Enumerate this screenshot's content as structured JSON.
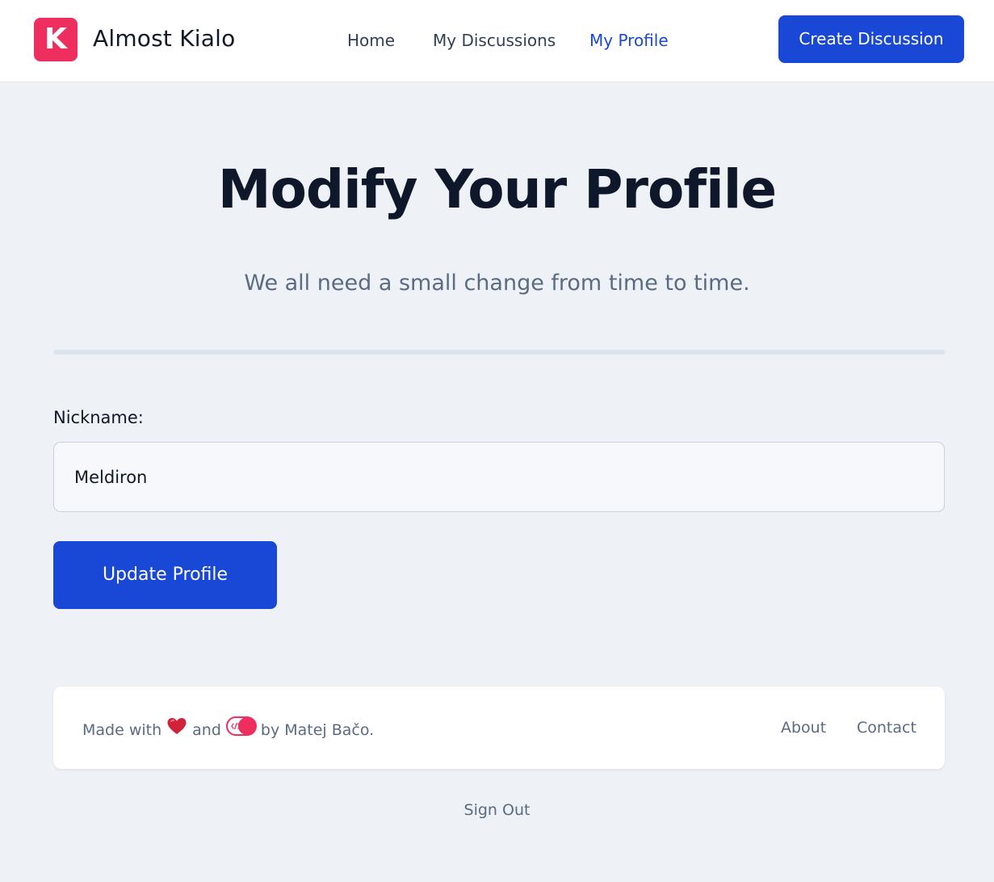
{
  "header": {
    "logo_letter": "K",
    "brand": "Almost Kialo",
    "nav": [
      {
        "label": "Home",
        "active": false
      },
      {
        "label": "My Discussions",
        "active": false
      },
      {
        "label": "My Profile",
        "active": true
      }
    ],
    "cta_label": "Create Discussion"
  },
  "main": {
    "title": "Modify Your Profile",
    "subtitle": "We all need a small change from time to time.",
    "form": {
      "nickname_label": "Nickname:",
      "nickname_value": "Meldiron",
      "submit_label": "Update Profile"
    }
  },
  "footer": {
    "text_made_with": "Made with",
    "text_and": "and",
    "text_by": "by Matej Bačo.",
    "icons": [
      "heart-icon",
      "toggle-icon"
    ],
    "links": [
      "About",
      "Contact"
    ]
  },
  "signout_label": "Sign Out",
  "colors": {
    "accent": "#1a48d6",
    "brand_pink": "#ee2e5f",
    "page_background": "#eef1f6",
    "muted_text": "#5b6b82"
  }
}
